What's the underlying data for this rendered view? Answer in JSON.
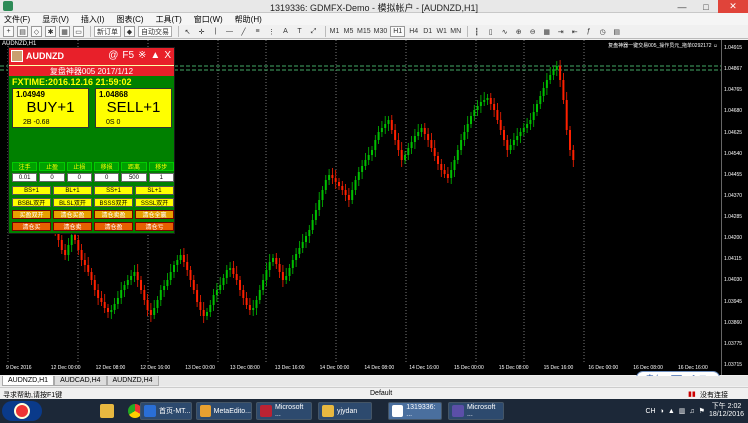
{
  "window": {
    "title": "1319336: GDMFX-Demo - 模拟帐户 - [AUDNZD,H1]",
    "controls": [
      "—",
      "□",
      "✕"
    ]
  },
  "menu": [
    "文件(F)",
    "显示(V)",
    "插入(I)",
    "图表(C)",
    "工具(T)",
    "窗口(W)",
    "帮助(H)"
  ],
  "toolbar": {
    "new_order": "新订单",
    "auto_trade": "自动交易",
    "timeframes": [
      "M1",
      "M5",
      "M15",
      "M30",
      "H1",
      "H4",
      "D1",
      "W1",
      "MN"
    ],
    "active_timeframe": "H1"
  },
  "chart": {
    "symbol_label": "AUDNZD,H1",
    "ea_label": "复盘神器一键交易005_操作员元_拖单0292172 ☺",
    "y_ticks": [
      "1.04915",
      "1.04867",
      "1.04765",
      "1.04680",
      "1.04625",
      "1.04540",
      "1.04455",
      "1.04370",
      "1.04285",
      "1.04200",
      "1.04115",
      "1.04030",
      "1.03945",
      "1.03860",
      "1.03775",
      "1.03715"
    ],
    "x_ticks": [
      "9 Dec 2016",
      "9 Dec 20:00",
      "12 Dec 00:00",
      "12 Dec 04:00",
      "12 Dec 08:00",
      "12 Dec 12:00",
      "12 Dec 16:00",
      "12 Dec 20:00",
      "13 Dec 00:00",
      "13 Dec 04:00",
      "13 Dec 08:00",
      "13 Dec 12:00",
      "13 Dec 16:00",
      "13 Dec 20:00",
      "14 Dec 00:00",
      "14 Dec 04:00",
      "14 Dec 08:00",
      "14 Dec 12:00",
      "14 Dec 16:00",
      "14 Dec 20:00",
      "15 Dec 00:00",
      "15 Dec 04:00",
      "15 Dec 08:00",
      "15 Dec 12:00",
      "15 Dec 16:00",
      "15 Dec 20:00",
      "16 Dec 00:00",
      "16 Dec 04:00",
      "16 Dec 08:00",
      "16 Dec 12:00",
      "16 Dec 16:00",
      "16 Dec 20:00"
    ]
  },
  "panel": {
    "symbol": "AUDNZD",
    "icons": [
      "@",
      "F5",
      "※",
      "▲",
      "X"
    ],
    "subtitle": "复盘神器005 2017/1/12",
    "time": "FXTIME:2016.12.16 21:59:02",
    "buy": {
      "price": "1.04949",
      "label": "BUY+1",
      "note": "2B -0.68"
    },
    "sell": {
      "price": "1.04868",
      "label": "SELL+1",
      "note": "0S 0"
    },
    "headers": [
      "注手",
      "止盈",
      "止损",
      "移损",
      "距离",
      "移步"
    ],
    "values": [
      "0.01",
      "0",
      "0",
      "0",
      "500",
      "1"
    ],
    "row1": [
      "BS+1",
      "BL+1",
      "SS+1",
      "SL+1"
    ],
    "row2": [
      "BSBL双开",
      "BLSL双开",
      "BSSS双开",
      "SSSL双开"
    ],
    "row3": [
      "买盈双开",
      "清仓买盈",
      "清仓卖盈",
      "清仓全赢"
    ],
    "row4": [
      "清仓买",
      "清仓卖",
      "清仓盈",
      "清仓亏"
    ]
  },
  "tabs": [
    "AUDNZD,H1",
    "AUDCAD,H4",
    "AUDNZD,H4"
  ],
  "status": {
    "help": "寻求帮助,请按F1键",
    "profile": "Default",
    "connection": "没有连接"
  },
  "taskbar": {
    "items": [
      "首页-MT...",
      "MetaEdito...",
      "Microsoft ...",
      "yjydan",
      "1319336: ...",
      "Microsoft ..."
    ],
    "lang": "CH",
    "time": "下午 2:02",
    "date": "18/12/2016"
  },
  "colors": {
    "bull": "#00c000",
    "bear": "#ff2000",
    "panel_green": "#008000",
    "panel_red": "#e8202a",
    "accent_yellow": "#ffff00"
  }
}
